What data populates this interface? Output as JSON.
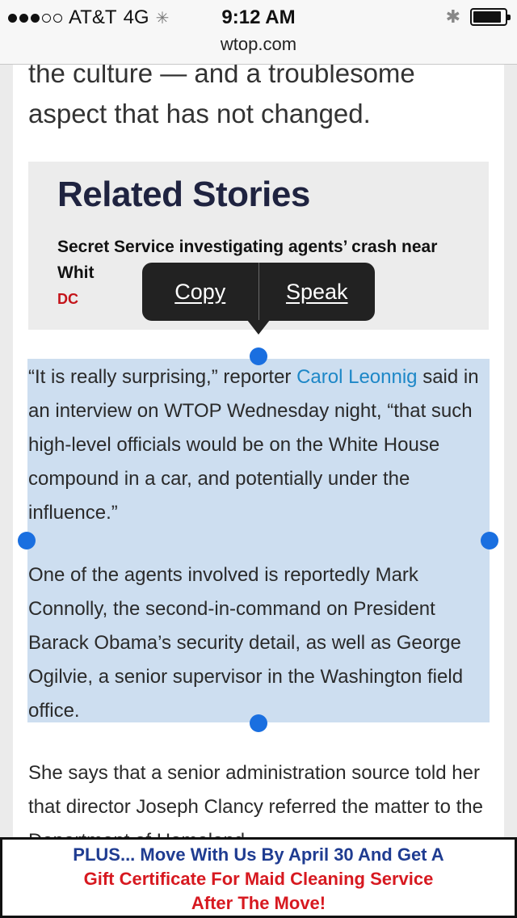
{
  "status_bar": {
    "carrier": "AT&T",
    "network": "4G",
    "time": "9:12 AM",
    "url": "wtop.com",
    "signal_bars_filled": 3,
    "signal_bars_total": 5,
    "battery_level": 0.9
  },
  "article": {
    "top_text": "the culture — and a troublesome aspect that has not changed.",
    "related": {
      "title": "Related Stories",
      "story": "Secret Service investigating agents’ crash near Whit",
      "tag": "DC"
    },
    "p1_before": "“It is really surprising,” reporter ",
    "p1_link": "Carol Leonnig",
    "p1_after": " said in an interview on WTOP Wednesday night, “that such high-level officials would be on the White House compound in a car, and potentially under the influence.”",
    "p2": "One of the agents involved is reportedly Mark Connolly, the second-in-command on President Barack Obama’s security detail, as well as George Ogilvie, a senior supervisor in the Washington field office.",
    "p3": "She says that a senior administration source told her that director Joseph Clancy referred the matter to the Department of Homeland"
  },
  "context_menu": {
    "copy": "Copy",
    "speak": "Speak"
  },
  "ad": {
    "line1": "PLUS... Move With Us By April 30 And Get A",
    "line2": "Gift Certificate For Maid Cleaning Service",
    "line3": "After The Move!"
  },
  "colors": {
    "link": "#1d87c7",
    "selection": "#cddef0",
    "handle": "#1a6fe0",
    "tag": "#c4141a",
    "ad_blue": "#1f3c91",
    "ad_red": "#d71920"
  }
}
